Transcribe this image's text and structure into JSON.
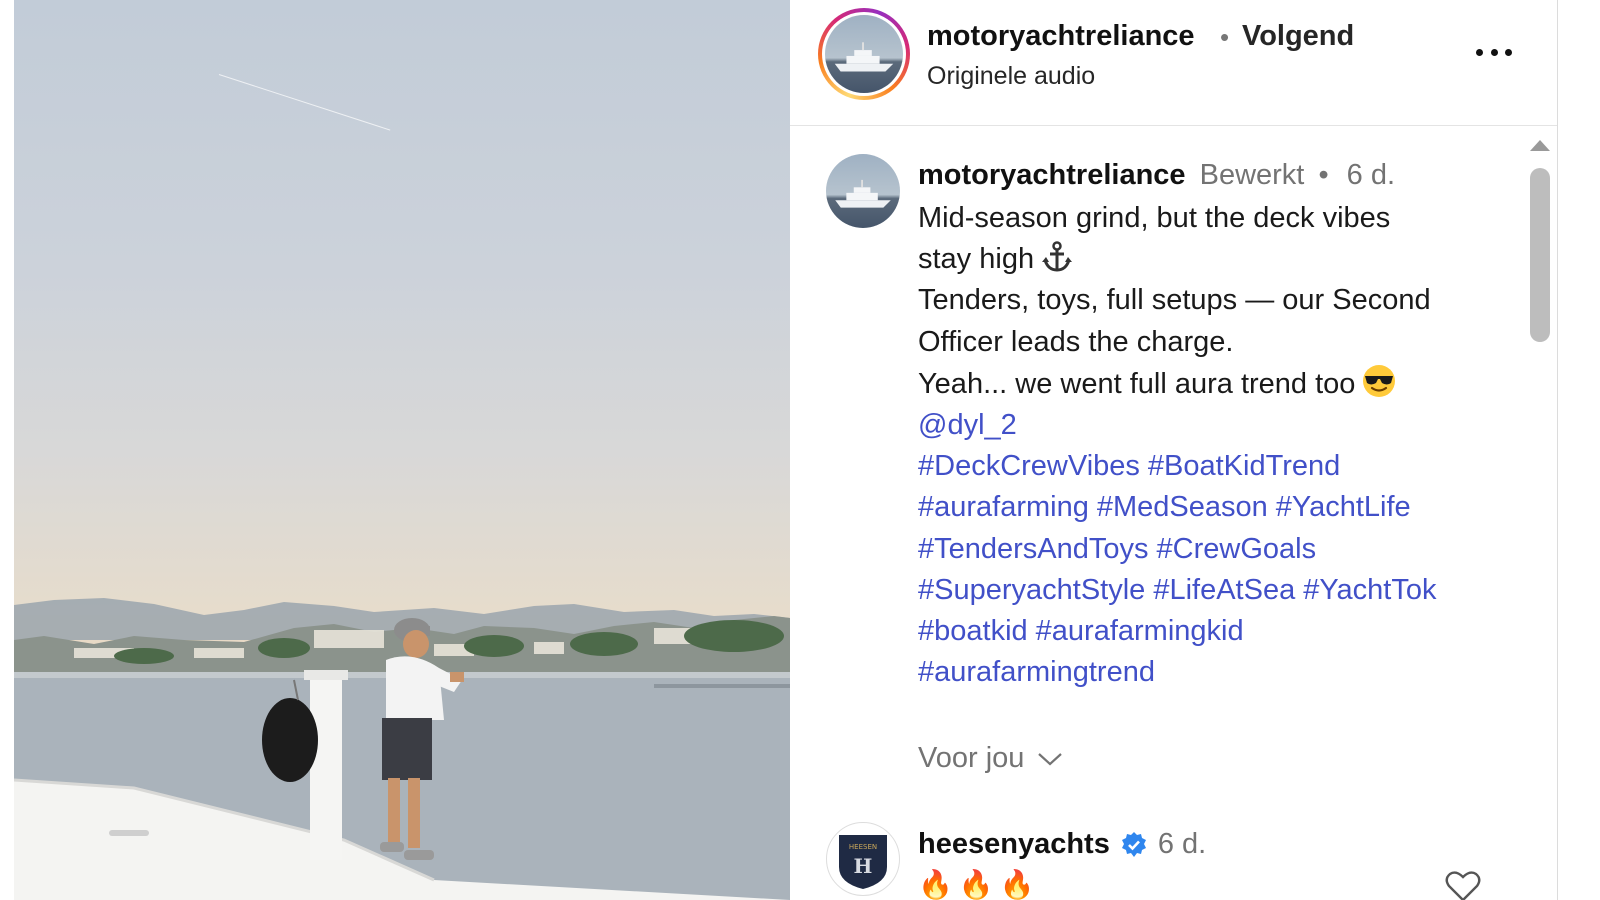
{
  "header": {
    "username": "motoryachtreliance",
    "separator": "•",
    "follow_status": "Volgend",
    "audio": "Originele audio",
    "more_icon": "more-horizontal-icon"
  },
  "caption": {
    "username": "motoryachtreliance",
    "edited": "Bewerkt",
    "separator": "•",
    "time": "6 d.",
    "lines": [
      "Mid-season grind, but the deck vibes",
      "stay high",
      "Tenders, toys, full setups — our Second",
      "Officer leads the charge.",
      "Yeah... we went full aura trend too"
    ],
    "mention": "@dyl_2",
    "hashtag_lines": [
      [
        "#DeckCrewVibes",
        "#BoatKidTrend"
      ],
      [
        "#aurafarming",
        "#MedSeason",
        "#YachtLife"
      ],
      [
        "#TendersAndToys",
        "#CrewGoals"
      ],
      [
        "#SuperyachtStyle",
        "#LifeAtSea",
        "#YachtTok"
      ],
      [
        "#boatkid",
        "#aurafarmingkid"
      ],
      [
        "#aurafarmingtrend"
      ]
    ],
    "anchor_emoji_icon": "anchor-icon",
    "sunglasses_emoji_icon": "sunglasses-face-icon"
  },
  "for_you": {
    "label": "Voor jou",
    "icon": "chevron-down-icon"
  },
  "comment": {
    "username": "heesenyachts",
    "verified_icon": "verified-badge-icon",
    "time": "6 d.",
    "emojis": "🔥🔥🔥",
    "like_icon": "heart-icon"
  },
  "colors": {
    "link": "#4150c8",
    "muted": "#737373",
    "verified": "#2f86ee"
  }
}
